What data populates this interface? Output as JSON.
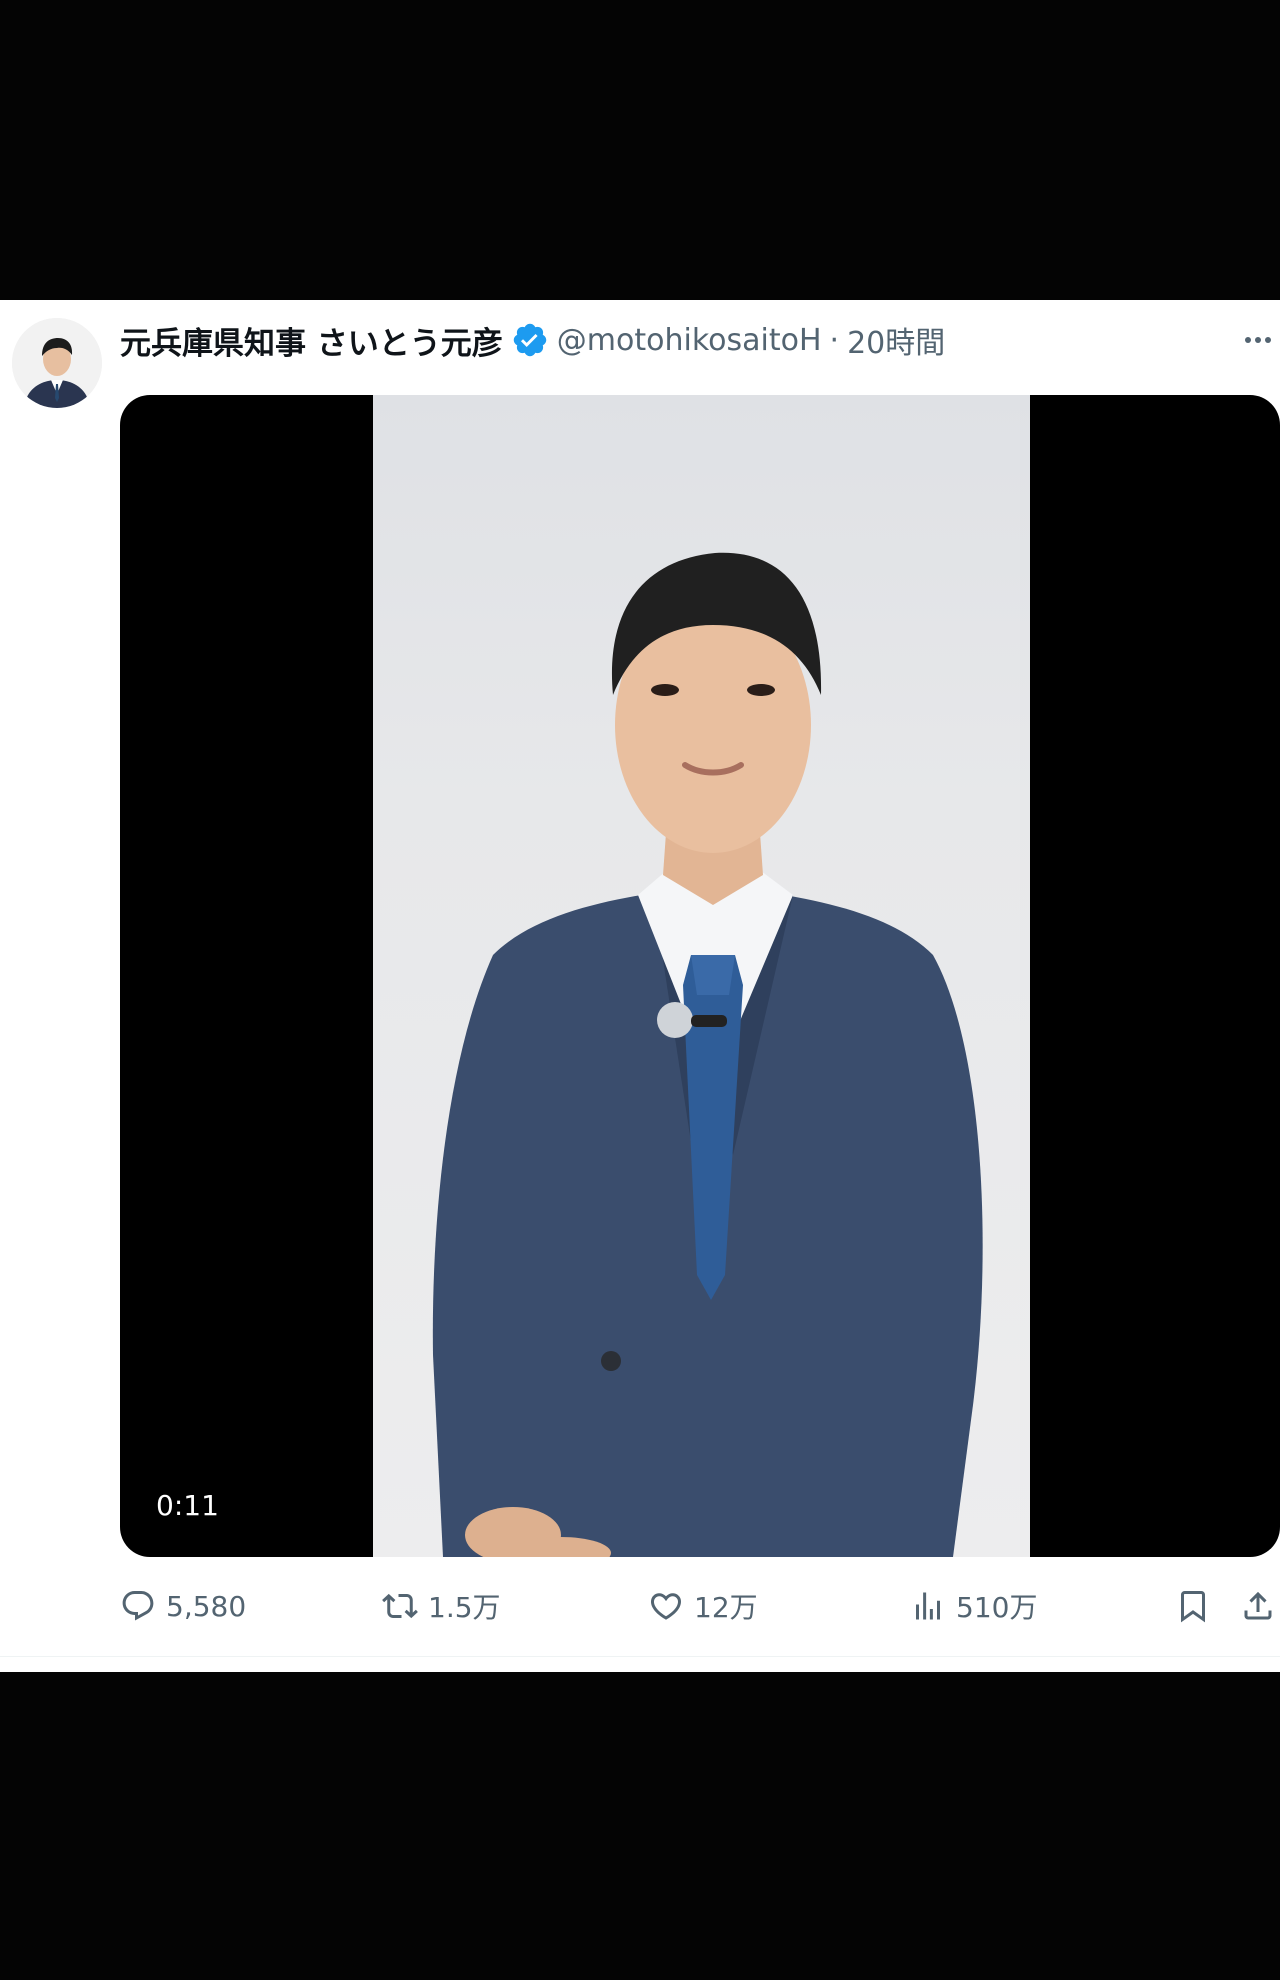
{
  "tweet": {
    "author_name": "元兵庫県知事 さいとう元彦",
    "handle": "@motohikosaitoH",
    "separator": "·",
    "time": "20時間"
  },
  "media": {
    "duration": "0:11"
  },
  "actions": {
    "reply_count": "5,580",
    "retweet_count": "1.5万",
    "like_count": "12万",
    "view_count": "510万"
  },
  "icons": {
    "verified": "verified-badge-icon",
    "more": "more-icon",
    "reply": "reply-icon",
    "retweet": "retweet-icon",
    "like": "heart-icon",
    "views": "views-icon",
    "bookmark": "bookmark-icon",
    "share": "share-icon"
  },
  "colors": {
    "verified_blue": "#1d9bf0",
    "text_primary": "#0f1419",
    "text_secondary": "#536471"
  }
}
